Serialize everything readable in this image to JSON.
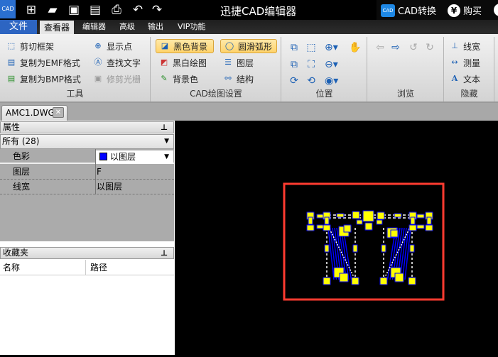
{
  "titlebar": {
    "logo": "CAD",
    "title": "迅捷CAD编辑器",
    "convert": "CAD转换",
    "buy": "购买",
    "icons": [
      "new-icon",
      "open-icon",
      "save-icon",
      "save-pdf-icon",
      "print-icon",
      "undo-icon",
      "redo-icon"
    ]
  },
  "menu": {
    "file": "文件",
    "tabs": [
      "查看器",
      "编辑器",
      "高级",
      "输出",
      "VIP功能"
    ]
  },
  "ribbon": {
    "tools": {
      "label": "工具",
      "items": [
        "剪切框架",
        "复制为EMF格式",
        "复制为BMP格式",
        "显示点",
        "查找文字",
        "修剪光栅"
      ]
    },
    "cad": {
      "label": "CAD绘图设置",
      "items": [
        "黑色背景",
        "黑白绘图",
        "背景色",
        "圆滑弧形",
        "图层",
        "结构"
      ]
    },
    "position": {
      "label": "位置"
    },
    "browse": {
      "label": "浏览"
    },
    "hide": {
      "label": "隐藏",
      "items": [
        "线宽",
        "测量",
        "文本"
      ]
    }
  },
  "doc_tab": "AMC1.DWG",
  "properties": {
    "title": "属性",
    "filter": "所有 (28)",
    "rows": [
      {
        "key": "色彩",
        "value": "以图层"
      },
      {
        "key": "图层",
        "value": "F"
      },
      {
        "key": "线宽",
        "value": "以图层"
      }
    ],
    "color_swatch": "#0000ff"
  },
  "favorites": {
    "title": "收藏夹",
    "columns": [
      "名称",
      "路径"
    ]
  },
  "colors": {
    "highlight": "#ff3b30",
    "entity_fill": "#ffff00",
    "entity_stroke": "#0000ff"
  }
}
